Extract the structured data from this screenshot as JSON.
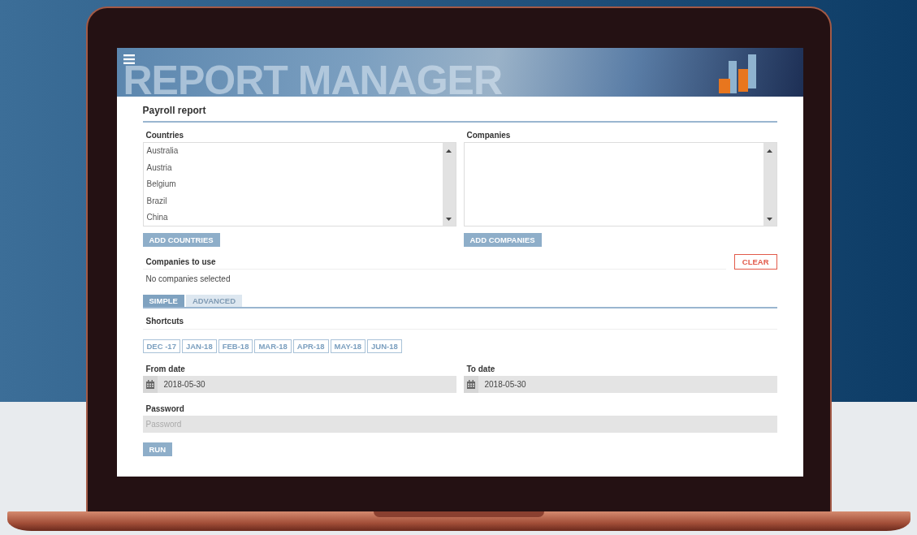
{
  "header": {
    "title": "REPORT MANAGER"
  },
  "page_title": "Payroll report",
  "countries": {
    "label": "Countries",
    "items": [
      "Australia",
      "Austria",
      "Belgium",
      "Brazil",
      "China"
    ],
    "button": "ADD COUNTRIES"
  },
  "companies": {
    "label": "Companies",
    "button": "ADD COMPANIES"
  },
  "companies_to_use": {
    "label": "Companies to use",
    "empty_text": "No companies selected",
    "clear_button": "CLEAR"
  },
  "tabs": [
    {
      "label": "SIMPLE",
      "selected": true
    },
    {
      "label": "ADVANCED",
      "selected": false
    }
  ],
  "shortcuts": {
    "label": "Shortcuts",
    "items": [
      "DEC -17",
      "JAN-18",
      "FEB-18",
      "MAR-18",
      "APR-18",
      "MAY-18",
      "JUN-18"
    ]
  },
  "from_date": {
    "label": "From date",
    "value": "2018-05-30"
  },
  "to_date": {
    "label": "To date",
    "value": "2018-05-30"
  },
  "password": {
    "label": "Password",
    "placeholder": "Password"
  },
  "run_button": "RUN"
}
